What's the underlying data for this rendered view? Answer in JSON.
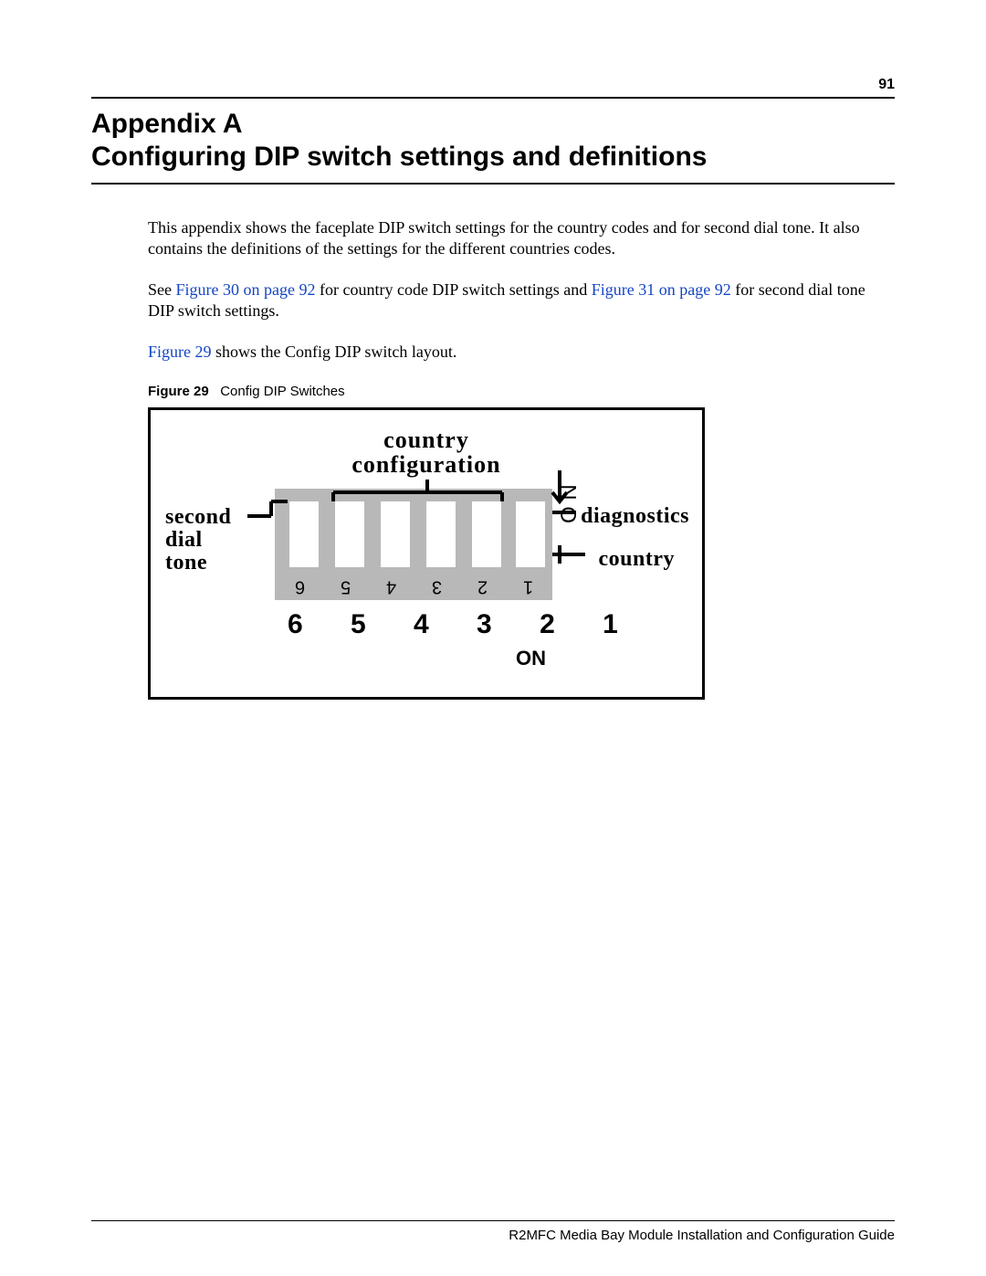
{
  "page_number": "91",
  "heading_line1": "Appendix A",
  "heading_line2": "Configuring DIP switch settings and definitions",
  "para1": "This appendix shows the faceplate DIP switch settings for the country codes and for second dial tone. It also contains the definitions of the settings for the different countries codes.",
  "para2_prefix": "See ",
  "xref1": "Figure 30 on page 92",
  "para2_mid": " for country code DIP switch settings and ",
  "xref2": "Figure 31 on page 92",
  "para2_suffix": " for second dial tone DIP switch settings.",
  "para3_prefix": "",
  "xref3": "Figure 29",
  "para3_suffix": " shows the Config DIP switch layout.",
  "figure_label": "Figure 29",
  "figure_title": "Config DIP Switches",
  "diagram": {
    "top_label_line1": "country",
    "top_label_line2": "configuration",
    "left_label_line1": "second",
    "left_label_line2": "dial",
    "left_label_line3": "tone",
    "right_label1": "diagnostics",
    "right_label2": "country",
    "on_vertical": "O N",
    "inverted_numbers": [
      "6",
      "5",
      "4",
      "3",
      "2",
      "1"
    ],
    "big_numbers": "6 5 4 3 2 1",
    "on_label": "ON"
  },
  "footer": "R2MFC Media Bay Module Installation and Configuration Guide"
}
